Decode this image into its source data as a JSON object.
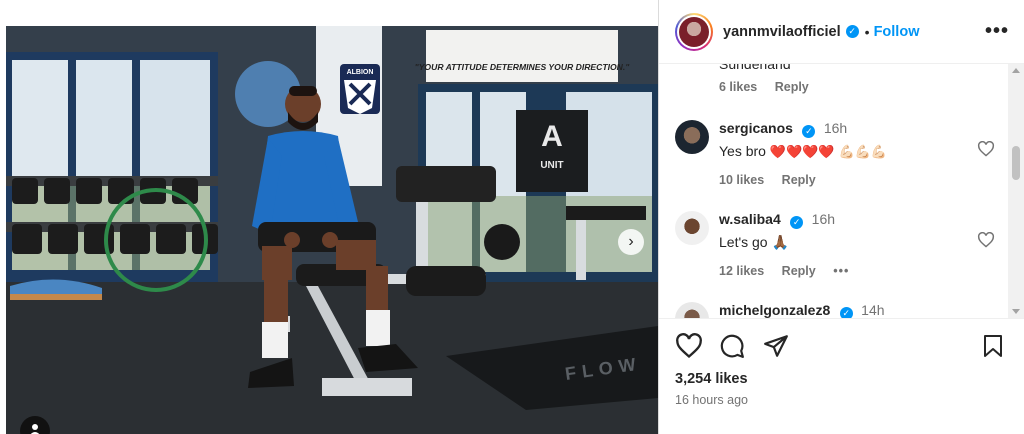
{
  "post": {
    "owner": "yannmvilaofficiel",
    "follow_label": "Follow",
    "separator": "•",
    "likes_text": "3,254 likes",
    "time_ago": "16 hours ago"
  },
  "photo": {
    "banner_text": "\"YOUR ATTITUDE DETERMINES YOUR DIRECTION.\"",
    "club_crest_text": "ALBION",
    "unit_sign_letter": "A",
    "unit_sign_text": "UNIT",
    "floor_mat_text": "FLOW"
  },
  "comments": {
    "partial_text": "Sunderland",
    "partial_likes": "6 likes",
    "reply_label": "Reply",
    "items": [
      {
        "user": "sergicanos",
        "time": "16h",
        "text": "Yes bro",
        "emoji_hearts": "❤️❤️❤️❤️",
        "emoji_arms": "💪🏻💪🏻💪🏻",
        "likes": "10 likes",
        "reply": "Reply"
      },
      {
        "user": "w.saliba4",
        "time": "16h",
        "text": "Let's go",
        "emoji": "🙏🏾",
        "likes": "12 likes",
        "reply": "Reply",
        "more": "•••"
      },
      {
        "user": "michelgonzalez8",
        "time": "14h"
      }
    ]
  },
  "icons": {
    "owner_verified": "verified-badge-icon",
    "more": "more-options-icon",
    "like": "heart-icon",
    "comment": "comment-icon",
    "share": "share-icon",
    "save": "bookmark-icon",
    "next": "chevron-right-icon",
    "tag": "user-tag-icon"
  },
  "colors": {
    "accent": "#0095f6",
    "text": "#262626",
    "muted": "#737373",
    "jersey": "#1f6fc4"
  }
}
